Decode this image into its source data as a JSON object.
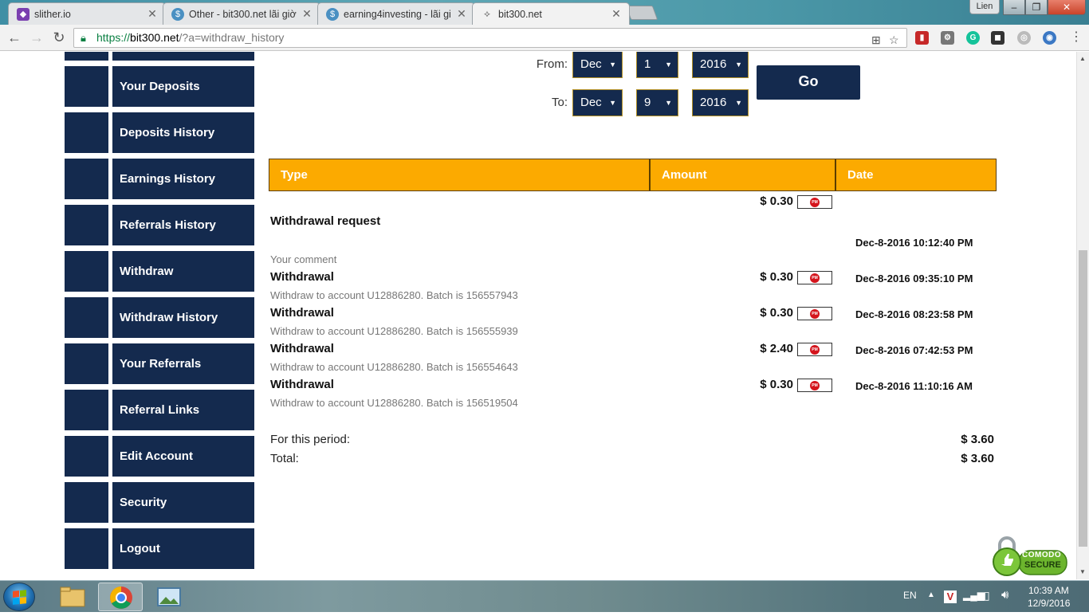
{
  "browser": {
    "tabs": [
      {
        "label": "slither.io",
        "active": false,
        "favicon": "slither-icon",
        "favicon_color": "#7a3fb0"
      },
      {
        "label": "Other - bit300.net lãi giờ",
        "active": false,
        "favicon": "dollar-coin-icon",
        "favicon_color": "#4a90c2"
      },
      {
        "label": "earning4investing - lãi gi",
        "active": false,
        "favicon": "dollar-coin-icon",
        "favicon_color": "#4a90c2"
      },
      {
        "label": "bit300.net",
        "active": true,
        "favicon": "wing-logo-icon",
        "favicon_color": "#8a8f96"
      }
    ],
    "close_glyph": "✕",
    "user_badge": "Lien",
    "address": {
      "scheme": "https://",
      "host": "bit300.net",
      "path": "/?a=withdraw_history"
    }
  },
  "sidebar": {
    "items": [
      {
        "label": ""
      },
      {
        "label": "Your Deposits"
      },
      {
        "label": "Deposits History"
      },
      {
        "label": "Earnings History"
      },
      {
        "label": "Referrals History"
      },
      {
        "label": "Withdraw"
      },
      {
        "label": "Withdraw History"
      },
      {
        "label": "Your Referrals"
      },
      {
        "label": "Referral Links"
      },
      {
        "label": "Edit Account"
      },
      {
        "label": "Security"
      },
      {
        "label": "Logout"
      }
    ]
  },
  "filter": {
    "from_label": "From:",
    "to_label": "To:",
    "from": {
      "month": "Dec",
      "day": "1",
      "year": "2016"
    },
    "to": {
      "month": "Dec",
      "day": "9",
      "year": "2016"
    },
    "go_label": "Go"
  },
  "table": {
    "headers": [
      "Type",
      "Amount",
      "Date"
    ],
    "header_color": "#fcaa00",
    "pending": {
      "amount": "$ 0.30",
      "title": "Withdrawal request",
      "date": "Dec-8-2016 10:12:40 PM",
      "comment": "Your comment"
    },
    "rows": [
      {
        "title": "Withdrawal",
        "amount": "$ 0.30",
        "date": "Dec-8-2016 09:35:10 PM",
        "detail": "Withdraw to account U12886280. Batch is 156557943"
      },
      {
        "title": "Withdrawal",
        "amount": "$ 0.30",
        "date": "Dec-8-2016 08:23:58 PM",
        "detail": "Withdraw to account U12886280. Batch is 156555939"
      },
      {
        "title": "Withdrawal",
        "amount": "$ 2.40",
        "date": "Dec-8-2016 07:42:53 PM",
        "detail": "Withdraw to account U12886280. Batch is 156554643"
      },
      {
        "title": "Withdrawal",
        "amount": "$ 0.30",
        "date": "Dec-8-2016 11:10:16 AM",
        "detail": "Withdraw to account U12886280. Batch is 156519504"
      }
    ],
    "payment_badge": "PM"
  },
  "summary": {
    "period_label": "For this period:",
    "period_value": "$ 3.60",
    "total_label": "Total:",
    "total_value": "$ 3.60"
  },
  "seal": {
    "line1": "COMODO",
    "line2": "SECURE"
  },
  "taskbar": {
    "lang": "EN",
    "time": "10:39 AM",
    "date": "12/9/2016"
  },
  "colors": {
    "navy": "#142a4e",
    "orange": "#fcaa00"
  }
}
